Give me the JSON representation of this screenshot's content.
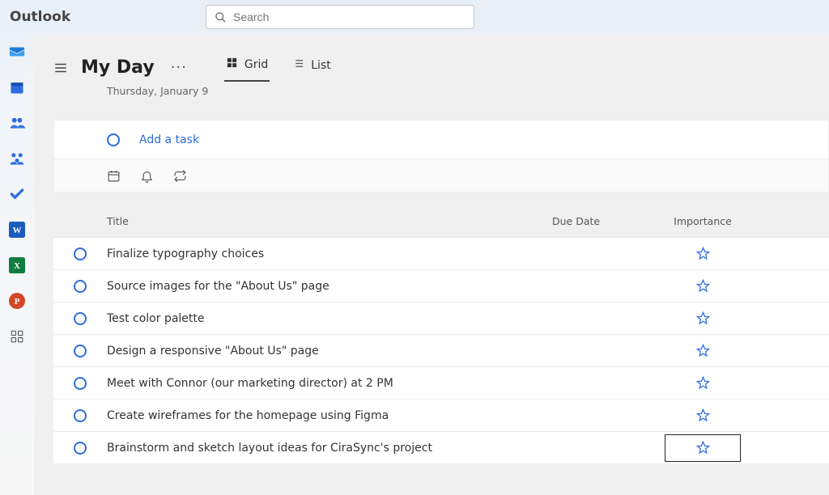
{
  "app": {
    "brand": "Outlook"
  },
  "search": {
    "placeholder": "Search"
  },
  "header": {
    "title": "My Day",
    "date": "Thursday, January 9",
    "views": {
      "grid": "Grid",
      "list": "List",
      "active": "grid"
    }
  },
  "addTask": {
    "label": "Add a task"
  },
  "columns": {
    "title": "Title",
    "due": "Due Date",
    "importance": "Importance"
  },
  "tasks": [
    {
      "title": "Finalize typography choices",
      "due": "",
      "important": false,
      "focused": false
    },
    {
      "title": "Source images for the \"About Us\" page",
      "due": "",
      "important": false,
      "focused": false
    },
    {
      "title": "Test color palette",
      "due": "",
      "important": false,
      "focused": false
    },
    {
      "title": "Design a responsive \"About Us\" page",
      "due": "",
      "important": false,
      "focused": false
    },
    {
      "title": "Meet with Connor (our marketing director) at 2 PM",
      "due": "",
      "important": false,
      "focused": false
    },
    {
      "title": "Create wireframes for the homepage using Figma",
      "due": "",
      "important": false,
      "focused": false
    },
    {
      "title": "Brainstorm and sketch layout ideas for CiraSync's project",
      "due": "",
      "important": false,
      "focused": true
    }
  ],
  "railApps": [
    "mail",
    "calendar",
    "people",
    "groups",
    "todo",
    "word",
    "excel",
    "powerpoint",
    "more-apps"
  ]
}
